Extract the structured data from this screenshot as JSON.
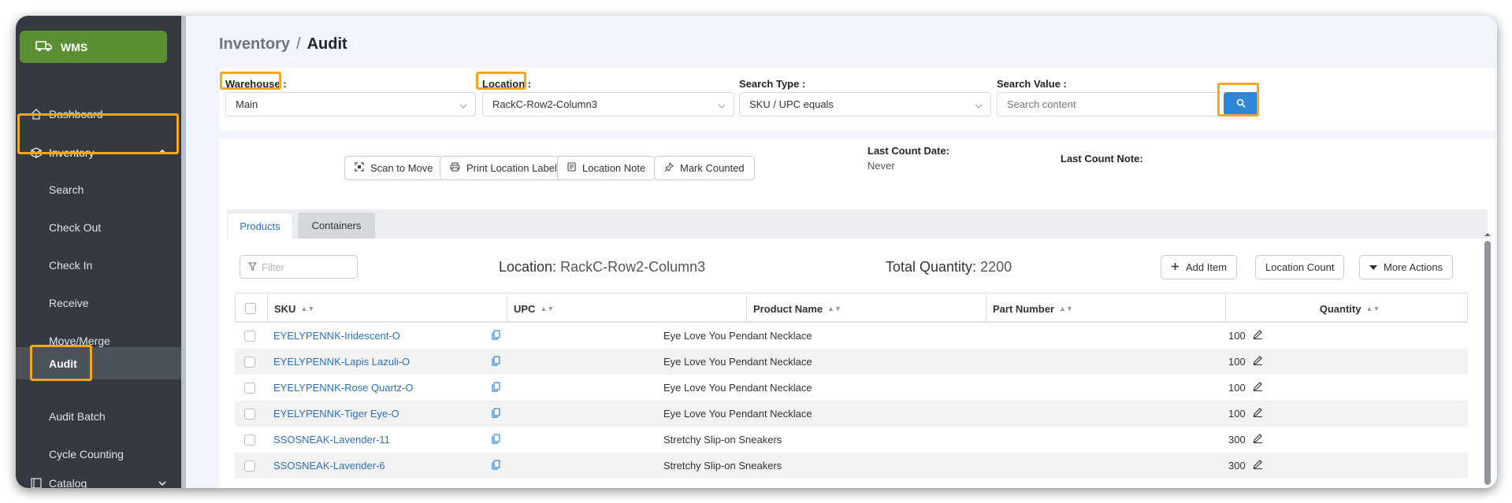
{
  "colors": {
    "brand": "#5a8f34",
    "sidebar": "#343a40",
    "accent": "#2f85d6",
    "link": "#2f6fb8",
    "highlight": "#f5a623"
  },
  "sidebar": {
    "brand": "WMS",
    "brand_icon": "truck-icon",
    "items": [
      {
        "label": "Dashboard",
        "icon": "home-icon"
      },
      {
        "label": "Inventory",
        "icon": "box-icon",
        "expanded": true
      },
      {
        "label": "Catalog",
        "icon": "catalog-icon"
      }
    ],
    "sub_items": [
      "Search",
      "Check Out",
      "Check In",
      "Receive",
      "Move/Merge",
      "Audit",
      "Audit Batch",
      "Cycle Counting"
    ],
    "active_sub": "Audit"
  },
  "breadcrumb": {
    "parent": "Inventory",
    "separator": "/",
    "current": "Audit"
  },
  "filters": {
    "warehouse": {
      "label": "Warehouse :",
      "value": "Main"
    },
    "location": {
      "label": "Location :",
      "value": "RackC-Row2-Column3"
    },
    "search_type": {
      "label": "Search Type :",
      "value": "SKU / UPC equals"
    },
    "search_value": {
      "label": "Search Value :",
      "placeholder": "Search content"
    }
  },
  "actions": {
    "scan": "Scan to Move",
    "print": "Print Location Label",
    "note": "Location Note",
    "mark": "Mark Counted"
  },
  "meta": {
    "last_count_date_label": "Last Count Date:",
    "last_count_date_value": "Never",
    "last_count_note_label": "Last Count Note:"
  },
  "tabs": [
    {
      "label": "Products",
      "active": true
    },
    {
      "label": "Containers",
      "active": false
    }
  ],
  "toolbar": {
    "filter_placeholder": "Filter",
    "location_label": "Location:",
    "location_value": "RackC-Row2-Column3",
    "total_label": "Total Quantity:",
    "total_value": "2200",
    "add_item": "Add Item",
    "location_count": "Location Count",
    "more_actions": "More Actions"
  },
  "table": {
    "columns": [
      "SKU",
      "UPC",
      "Product Name",
      "Part Number",
      "Quantity"
    ],
    "rows": [
      {
        "sku": "EYELYPENNK-Iridescent-O",
        "upc": "",
        "name": "Eye Love You Pendant Necklace",
        "part": "",
        "qty": "100"
      },
      {
        "sku": "EYELYPENNK-Lapis Lazuli-O",
        "upc": "",
        "name": "Eye Love You Pendant Necklace",
        "part": "",
        "qty": "100"
      },
      {
        "sku": "EYELYPENNK-Rose Quartz-O",
        "upc": "",
        "name": "Eye Love You Pendant Necklace",
        "part": "",
        "qty": "100"
      },
      {
        "sku": "EYELYPENNK-Tiger Eye-O",
        "upc": "",
        "name": "Eye Love You Pendant Necklace",
        "part": "",
        "qty": "100"
      },
      {
        "sku": "SSOSNEAK-Lavender-11",
        "upc": "",
        "name": "Stretchy Slip-on Sneakers",
        "part": "",
        "qty": "300"
      },
      {
        "sku": "SSOSNEAK-Lavender-6",
        "upc": "",
        "name": "Stretchy Slip-on Sneakers",
        "part": "",
        "qty": "300"
      }
    ]
  }
}
